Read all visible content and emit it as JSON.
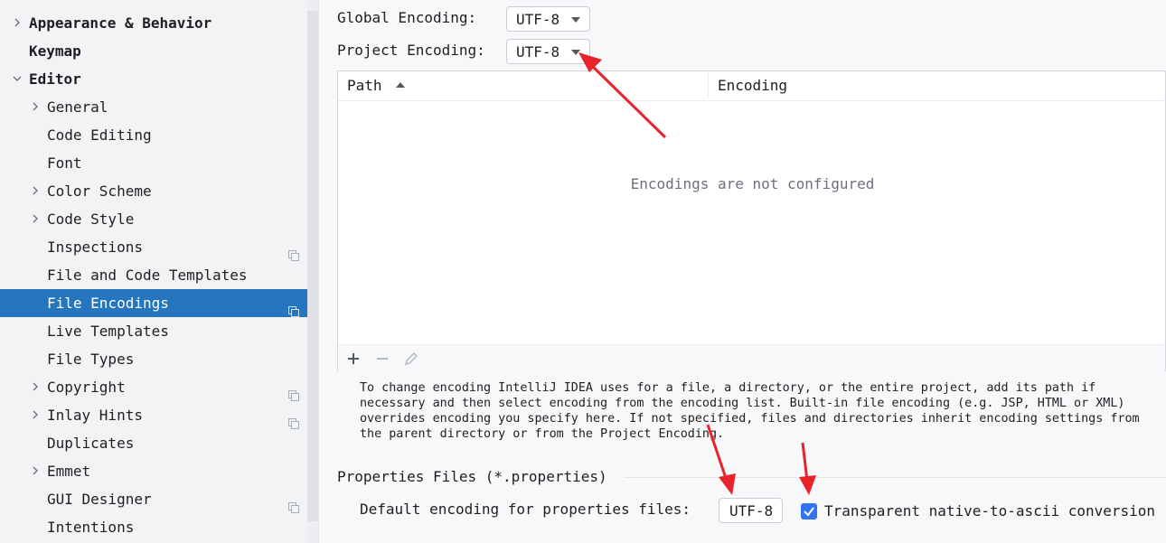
{
  "sidebar": {
    "items": [
      {
        "label": "Appearance & Behavior",
        "chevron": "right",
        "bold": true,
        "indent": 0
      },
      {
        "label": "Keymap",
        "chevron": "none",
        "bold": true,
        "indent": 0
      },
      {
        "label": "Editor",
        "chevron": "down",
        "bold": true,
        "indent": 0
      },
      {
        "label": "General",
        "chevron": "right",
        "bold": false,
        "indent": 1
      },
      {
        "label": "Code Editing",
        "chevron": "none",
        "bold": false,
        "indent": 1
      },
      {
        "label": "Font",
        "chevron": "none",
        "bold": false,
        "indent": 1
      },
      {
        "label": "Color Scheme",
        "chevron": "right",
        "bold": false,
        "indent": 1
      },
      {
        "label": "Code Style",
        "chevron": "right",
        "bold": false,
        "indent": 1
      },
      {
        "label": "Inspections",
        "chevron": "none",
        "bold": false,
        "indent": 1,
        "project_icon": true
      },
      {
        "label": "File and Code Templates",
        "chevron": "none",
        "bold": false,
        "indent": 1
      },
      {
        "label": "File Encodings",
        "chevron": "none",
        "bold": false,
        "indent": 1,
        "project_icon": true,
        "selected": true
      },
      {
        "label": "Live Templates",
        "chevron": "none",
        "bold": false,
        "indent": 1
      },
      {
        "label": "File Types",
        "chevron": "none",
        "bold": false,
        "indent": 1
      },
      {
        "label": "Copyright",
        "chevron": "right",
        "bold": false,
        "indent": 1,
        "project_icon": true
      },
      {
        "label": "Inlay Hints",
        "chevron": "right",
        "bold": false,
        "indent": 1,
        "project_icon": true
      },
      {
        "label": "Duplicates",
        "chevron": "none",
        "bold": false,
        "indent": 1
      },
      {
        "label": "Emmet",
        "chevron": "right",
        "bold": false,
        "indent": 1
      },
      {
        "label": "GUI Designer",
        "chevron": "none",
        "bold": false,
        "indent": 1,
        "project_icon": true
      },
      {
        "label": "Intentions",
        "chevron": "none",
        "bold": false,
        "indent": 1
      }
    ]
  },
  "main": {
    "global_encoding_label": "Global Encoding:",
    "global_encoding_value": "UTF-8",
    "project_encoding_label": "Project Encoding:",
    "project_encoding_value": "UTF-8",
    "table": {
      "columns": [
        "Path",
        "Encoding"
      ],
      "empty_text": "Encodings are not configured"
    },
    "toolbar": {
      "add_icon": "plus-icon",
      "remove_icon": "minus-icon",
      "edit_icon": "pencil-icon"
    },
    "help_text": "To change encoding IntelliJ IDEA uses for a file, a directory, or the entire project, add its path if necessary and then select encoding from the encoding list. Built-in file encoding (e.g. JSP, HTML or XML) overrides encoding you specify here. If not specified, files and directories inherit encoding settings from the parent directory or from the Project Encoding.",
    "properties_section": "Properties Files (*.properties)",
    "default_encoding_label": "Default encoding for properties files:",
    "default_encoding_value": "UTF-8",
    "transparent_label": "Transparent native-to-ascii conversion",
    "transparent_checked": true
  },
  "colors": {
    "selection": "#2675bf",
    "accent": "#3574f0",
    "annotation_arrow": "#e8232b"
  }
}
